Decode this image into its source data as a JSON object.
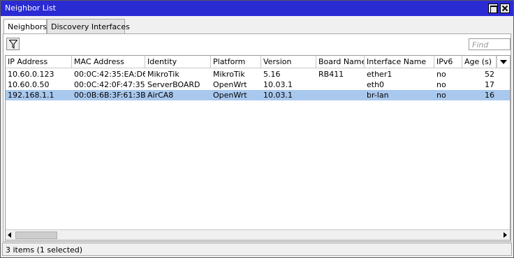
{
  "window": {
    "title": "Neighbor List"
  },
  "tabs": [
    {
      "label": "Neighbors",
      "active": true
    },
    {
      "label": "Discovery Interfaces",
      "active": false
    }
  ],
  "toolbar": {
    "filter_icon": "filter-icon",
    "find_placeholder": "Find"
  },
  "table": {
    "columns": [
      "IP Address",
      "MAC Address",
      "Identity",
      "Platform",
      "Version",
      "Board Name",
      "Interface Name",
      "IPv6",
      "Age (s)"
    ],
    "rows": [
      {
        "ip": "10.60.0.123",
        "mac": "00:0C:42:35:EA:D6",
        "identity": "MikroTik",
        "platform": "MikroTik",
        "version": "5.16",
        "board": "RB411",
        "iface": "ether1",
        "ipv6": "no",
        "age": "52",
        "selected": false
      },
      {
        "ip": "10.60.0.50",
        "mac": "00:0C:42:0F:47:35",
        "identity": "ServerBOARD",
        "platform": "OpenWrt",
        "version": "10.03.1",
        "board": "",
        "iface": "eth0",
        "ipv6": "no",
        "age": "17",
        "selected": false
      },
      {
        "ip": "192.168.1.1",
        "mac": "00:0B:6B:3F:61:3B",
        "identity": "AirCA8",
        "platform": "OpenWrt",
        "version": "10.03.1",
        "board": "",
        "iface": "br-lan",
        "ipv6": "no",
        "age": "16",
        "selected": true
      }
    ]
  },
  "status": {
    "text": "3 items (1 selected)"
  },
  "colors": {
    "titlebar": "#2b2bd4",
    "selected_row": "#a9c8ee"
  }
}
